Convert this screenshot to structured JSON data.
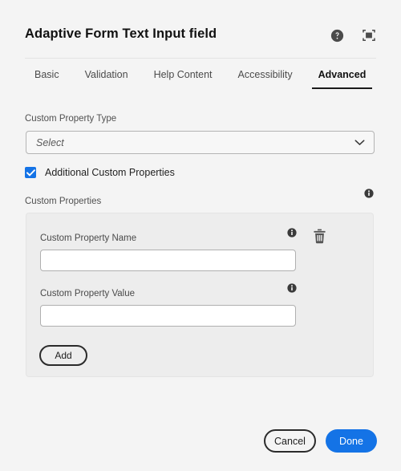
{
  "header": {
    "title": "Adaptive Form Text Input field",
    "help_icon": "help-circle-icon",
    "fullscreen_icon": "fullscreen-icon"
  },
  "tabs": [
    {
      "label": "Basic",
      "active": false
    },
    {
      "label": "Validation",
      "active": false
    },
    {
      "label": "Help Content",
      "active": false
    },
    {
      "label": "Accessibility",
      "active": false
    },
    {
      "label": "Advanced",
      "active": true
    }
  ],
  "form": {
    "custom_property_type": {
      "label": "Custom Property Type",
      "selected": "Select",
      "chevron_icon": "chevron-down-icon"
    },
    "additional_custom_properties": {
      "label": "Additional Custom Properties",
      "checked": true
    },
    "custom_properties": {
      "label": "Custom Properties",
      "info_icon": "info-icon",
      "row": {
        "name_label": "Custom Property Name",
        "name_value": "",
        "name_placeholder": "",
        "name_info_icon": "info-icon",
        "value_label": "Custom Property Value",
        "value_value": "",
        "value_placeholder": "",
        "value_info_icon": "info-icon",
        "delete_icon": "trash-icon"
      },
      "add_label": "Add"
    }
  },
  "footer": {
    "cancel_label": "Cancel",
    "done_label": "Done"
  },
  "colors": {
    "accent": "#1473e6",
    "page_bg": "#f4f4f4",
    "panel_bg": "#ededed",
    "text": "#2c2c2c"
  }
}
